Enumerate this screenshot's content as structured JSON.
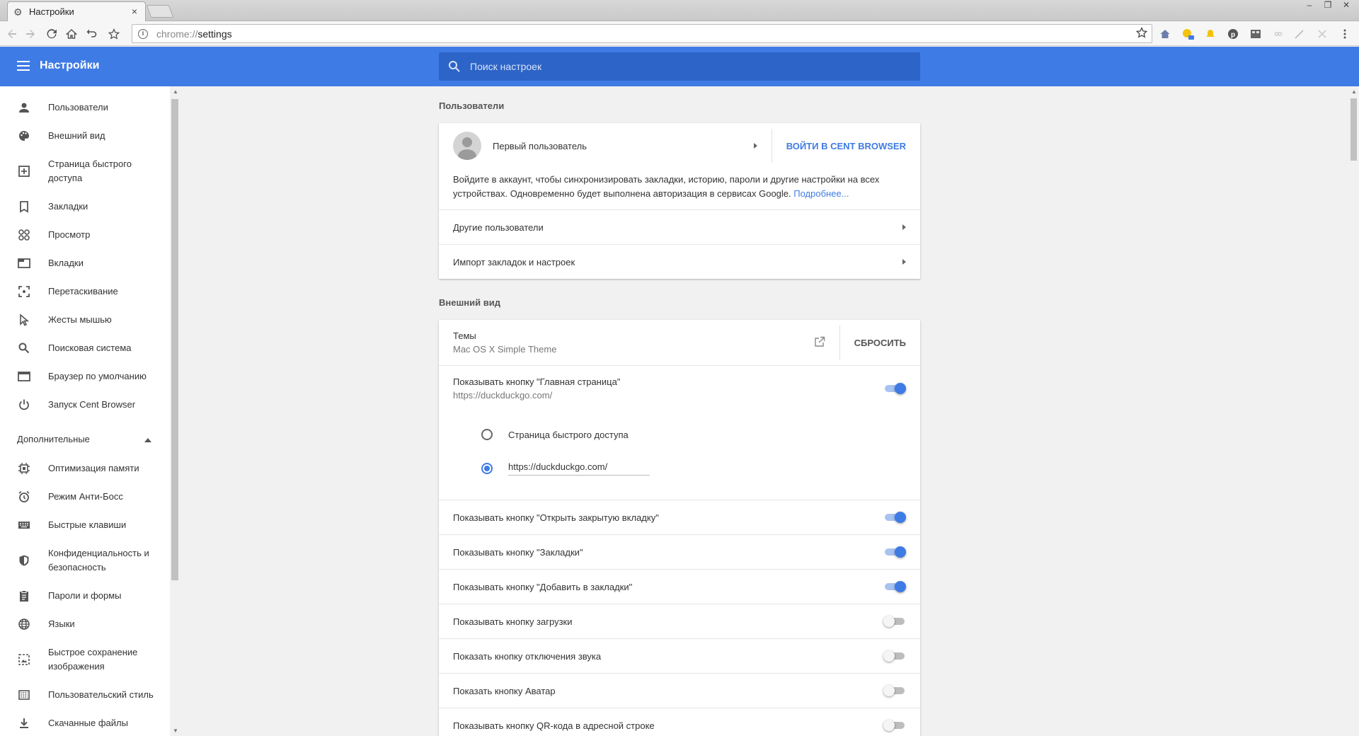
{
  "tab": {
    "title": "Настройки",
    "close": "×"
  },
  "window_controls": [
    "–",
    "❐",
    "✕"
  ],
  "omnibox": {
    "scheme": "chrome://",
    "path": "settings"
  },
  "header": {
    "title": "Настройки",
    "search_placeholder": "Поиск настроек"
  },
  "sidebar": {
    "items": [
      {
        "label": "Пользователи",
        "icon": "person-icon"
      },
      {
        "label": "Внешний вид",
        "icon": "palette-icon"
      },
      {
        "label": "Страница быстрого доступа",
        "icon": "add-box-icon"
      },
      {
        "label": "Закладки",
        "icon": "bookmark-icon"
      },
      {
        "label": "Просмотр",
        "icon": "browse-icon"
      },
      {
        "label": "Вкладки",
        "icon": "tab-icon"
      },
      {
        "label": "Перетаскивание",
        "icon": "drag-icon"
      },
      {
        "label": "Жесты мышью",
        "icon": "cursor-icon"
      },
      {
        "label": "Поисковая система",
        "icon": "search-icon"
      },
      {
        "label": "Браузер по умолчанию",
        "icon": "browser-icon"
      },
      {
        "label": "Запуск Cent Browser",
        "icon": "power-icon"
      }
    ],
    "advanced_label": "Дополнительные",
    "advanced_items": [
      {
        "label": "Оптимизация памяти",
        "icon": "memory-icon"
      },
      {
        "label": "Режим Анти-Босс",
        "icon": "alarm-icon"
      },
      {
        "label": "Быстрые клавиши",
        "icon": "keyboard-icon"
      },
      {
        "label": "Конфиденциальность и безопасность",
        "icon": "shield-icon"
      },
      {
        "label": "Пароли и формы",
        "icon": "clipboard-icon"
      },
      {
        "label": "Языки",
        "icon": "globe-icon"
      },
      {
        "label": "Быстрое сохранение изображения",
        "icon": "image-save-icon"
      },
      {
        "label": "Пользовательский стиль",
        "icon": "style-icon"
      },
      {
        "label": "Скачанные файлы",
        "icon": "download-icon"
      }
    ]
  },
  "users": {
    "section_title": "Пользователи",
    "profile_name": "Первый пользователь",
    "signin_button": "ВОЙТИ В CENT BROWSER",
    "signin_text": "Войдите в аккаунт, чтобы синхронизировать закладки, историю, пароли и другие настройки на всех устройствах. Одновременно будет выполнена авторизация в сервисах Google.",
    "learn_more": "Подробнее...",
    "other_users": "Другие пользователи",
    "import": "Импорт закладок и настроек"
  },
  "appearance": {
    "section_title": "Внешний вид",
    "themes_label": "Темы",
    "theme_name": "Mac OS X Simple Theme",
    "reset_button": "СБРОСИТЬ",
    "home_button_label": "Показывать кнопку \"Главная страница\"",
    "home_button_url": "https://duckduckgo.com/",
    "home_button_on": true,
    "radio_ntp": "Страница быстрого доступа",
    "radio_url_value": "https://duckduckgo.com/",
    "toggles": [
      {
        "label": "Показывать кнопку \"Открыть закрытую вкладку\"",
        "on": true
      },
      {
        "label": "Показывать кнопку \"Закладки\"",
        "on": true
      },
      {
        "label": "Показывать кнопку \"Добавить в закладки\"",
        "on": true
      },
      {
        "label": "Показывать кнопку загрузки",
        "on": false
      },
      {
        "label": "Показать кнопку отключения звука",
        "on": false
      },
      {
        "label": "Показать кнопку Аватар",
        "on": false
      },
      {
        "label": "Показывать кнопку QR-кода в адресной строке",
        "on": false
      }
    ]
  },
  "colors": {
    "accent": "#3f7be4",
    "header": "#3f7be4",
    "search_bg": "#2d64c7"
  }
}
